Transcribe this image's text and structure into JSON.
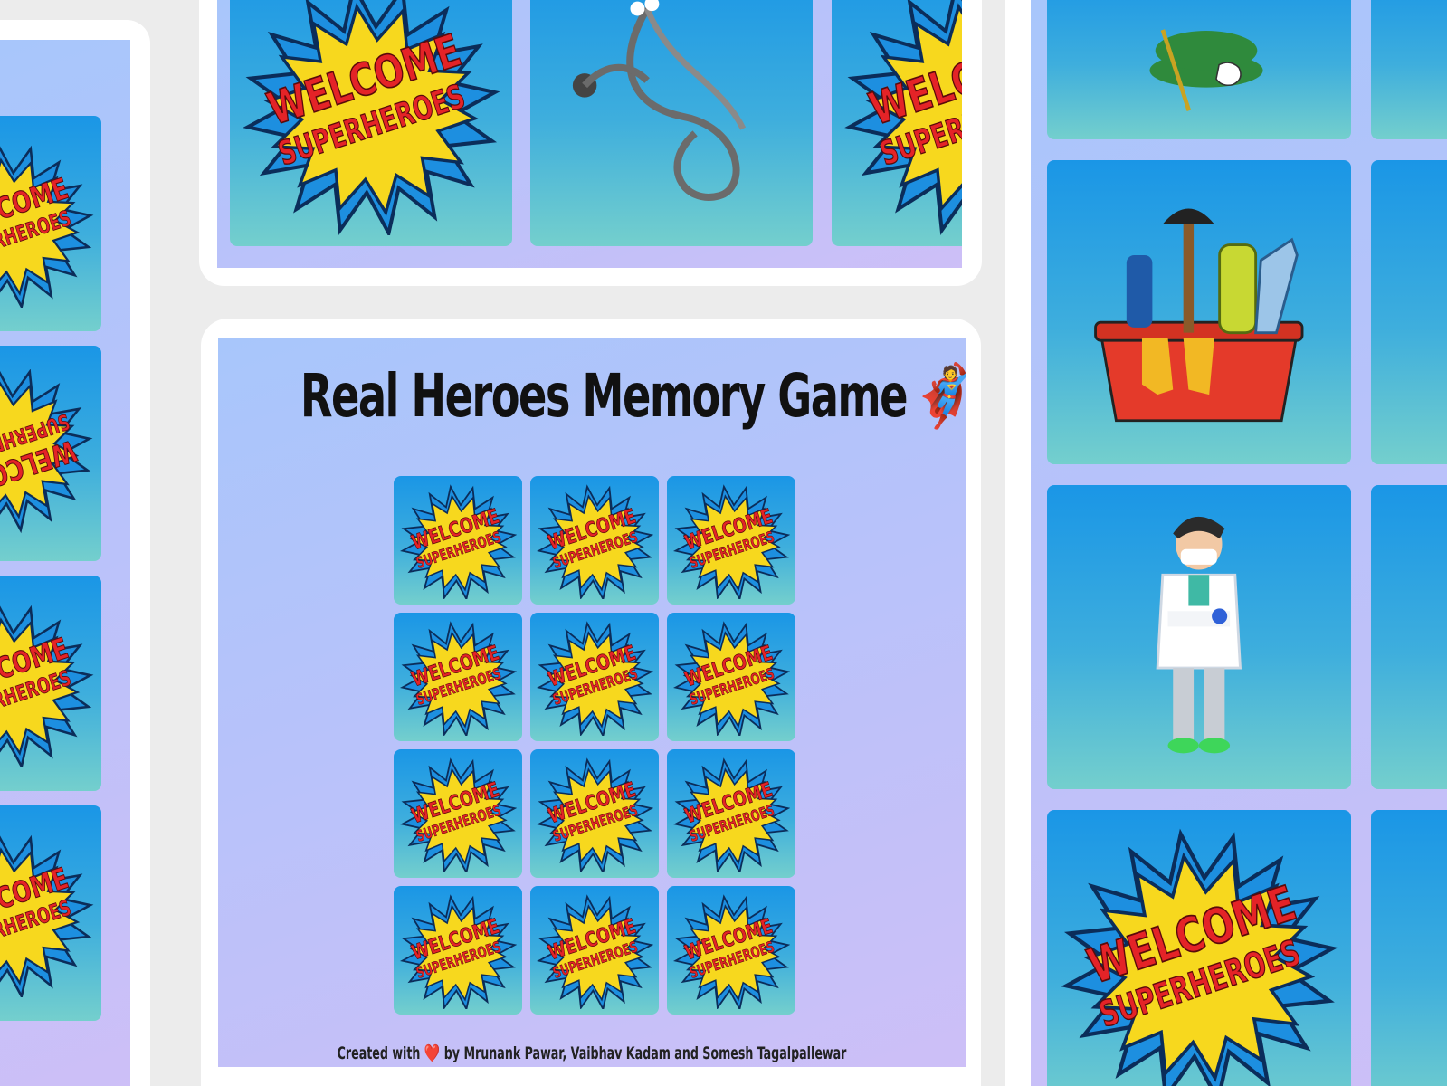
{
  "game": {
    "title": "Real Heroes Memory Game",
    "title_emoji": "🦸",
    "footer_prefix": "Created with",
    "footer_heart": "❤️",
    "footer_suffix": "by Mrunank Pawar, Vaibhav Kadam and Somesh Tagalpallewar"
  },
  "card_back": {
    "line1": "WELCOME",
    "line2": "SUPERHEROES"
  },
  "grid": {
    "rows": 4,
    "columns": 3,
    "cards": [
      {
        "face": "card-back"
      },
      {
        "face": "card-back"
      },
      {
        "face": "card-back"
      },
      {
        "face": "card-back"
      },
      {
        "face": "card-back"
      },
      {
        "face": "card-back"
      },
      {
        "face": "card-back"
      },
      {
        "face": "card-back"
      },
      {
        "face": "card-back"
      },
      {
        "face": "card-back"
      },
      {
        "face": "card-back"
      },
      {
        "face": "card-back"
      }
    ]
  },
  "side_cards": {
    "left": [
      "card-back",
      "card-back-rotated",
      "card-back",
      "card-back"
    ],
    "top": [
      "card-back",
      "stethoscope-icon",
      "card-back"
    ],
    "right": [
      "flag-hand-icon",
      "cleaning-bucket-icon",
      "doctor-icon",
      "card-back"
    ]
  },
  "colors": {
    "card_top": "#1a96e6",
    "card_bottom": "#74cfcd",
    "screen_blue": "#a8c6fb",
    "screen_violet": "#cdbff7",
    "burst_yellow": "#f7d81e",
    "burst_red": "#e42327"
  }
}
